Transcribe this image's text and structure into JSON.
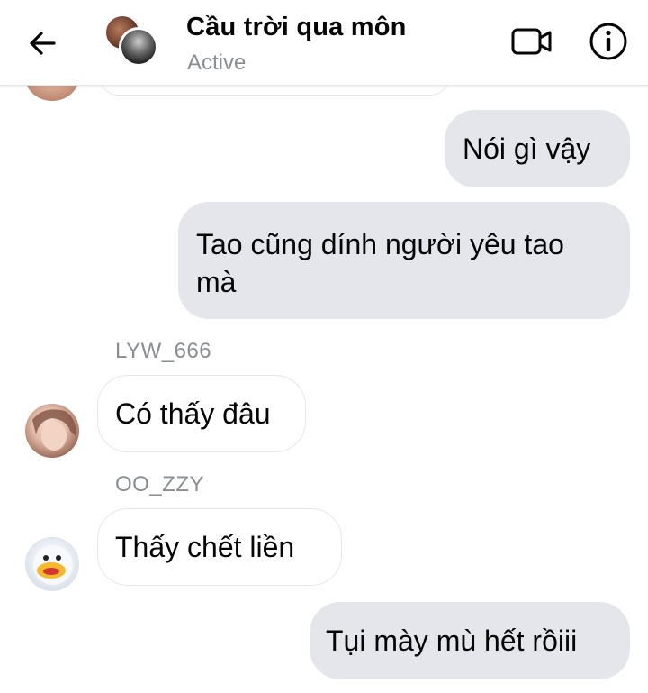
{
  "header": {
    "title": "Cầu trời qua môn",
    "status": "Active",
    "icons": {
      "back": "back-arrow-icon",
      "video": "video-call-icon",
      "info": "info-icon"
    }
  },
  "messages": [
    {
      "direction": "outgoing",
      "text": "Nói gì vậy"
    },
    {
      "direction": "outgoing",
      "lines": [
        "Tao cũng dính người yêu tao",
        "mà"
      ]
    },
    {
      "direction": "incoming",
      "sender": "LYW_666",
      "text": "Có thấy đâu"
    },
    {
      "direction": "incoming",
      "sender": "OO_ZZY",
      "text": "Thấy chết liền"
    },
    {
      "direction": "outgoing",
      "text": "Tụi mày mù hết rồiii"
    }
  ],
  "colors": {
    "outgoing_bubble": "#e4e6eb",
    "incoming_border": "#e4e6eb",
    "muted_text": "#8a8d91"
  }
}
